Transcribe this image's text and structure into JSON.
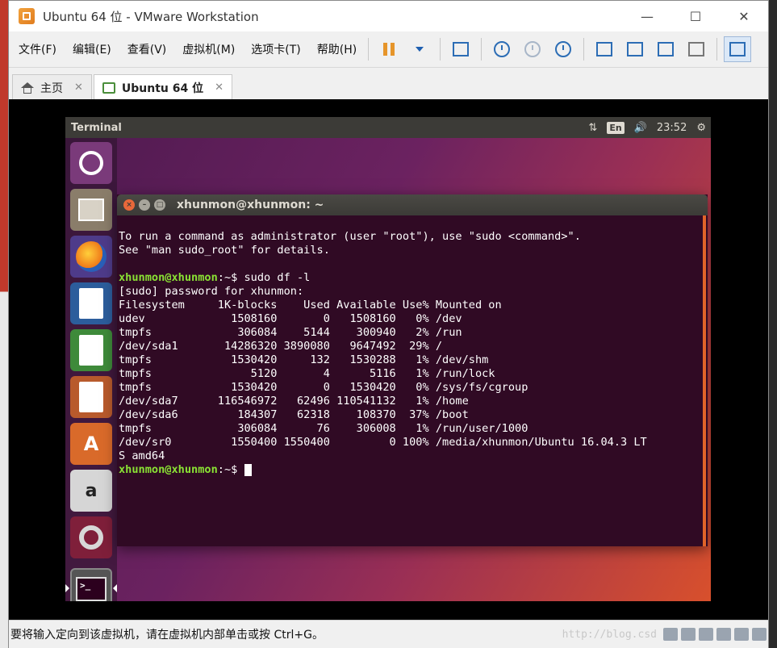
{
  "window": {
    "title": "Ubuntu 64 位 - VMware Workstation",
    "controls": {
      "minimize": "—",
      "maximize": "☐",
      "close": "✕"
    }
  },
  "menu": {
    "file": "文件(F)",
    "edit": "编辑(E)",
    "view": "查看(V)",
    "vm": "虚拟机(M)",
    "tabs": "选项卡(T)",
    "help": "帮助(H)"
  },
  "tabs": [
    {
      "label": "主页",
      "close": "✕"
    },
    {
      "label": "Ubuntu 64 位",
      "close": "✕"
    }
  ],
  "ubuntu": {
    "topbar_title": "Terminal",
    "lang": "En",
    "time": "23:52",
    "network_icon": "⇅",
    "volume_icon": "🔊",
    "settings_icon": "⚙",
    "amazon_label": "a",
    "store_label": "A"
  },
  "terminal": {
    "title": "xhunmon@xhunmon: ~",
    "lines": {
      "l1": "To run a command as administrator (user \"root\"), use \"sudo <command>\".",
      "l2": "See \"man sudo_root\" for details.",
      "l3_prompt": "xhunmon@xhunmon",
      "l3_cmd": ":~$ sudo df -l",
      "l4": "[sudo] password for xhunmon:",
      "l5": "Filesystem     1K-blocks    Used Available Use% Mounted on",
      "l6": "udev             1508160       0   1508160   0% /dev",
      "l7": "tmpfs             306084    5144    300940   2% /run",
      "l8": "/dev/sda1       14286320 3890080   9647492  29% /",
      "l9": "tmpfs            1530420     132   1530288   1% /dev/shm",
      "l10": "tmpfs               5120       4      5116   1% /run/lock",
      "l11": "tmpfs            1530420       0   1530420   0% /sys/fs/cgroup",
      "l12": "/dev/sda7      116546972   62496 110541132   1% /home",
      "l13": "/dev/sda6         184307   62318    108370  37% /boot",
      "l14": "tmpfs             306084      76    306008   1% /run/user/1000",
      "l15": "/dev/sr0         1550400 1550400         0 100% /media/xhunmon/Ubuntu 16.04.3 LT",
      "l16": "S amd64",
      "l17_prompt": "xhunmon@xhunmon",
      "l17_cmd": ":~$ "
    }
  },
  "statusbar": {
    "text": "要将输入定向到该虚拟机，请在虚拟机内部单击或按 Ctrl+G。",
    "watermark": "http://blog.csd"
  }
}
